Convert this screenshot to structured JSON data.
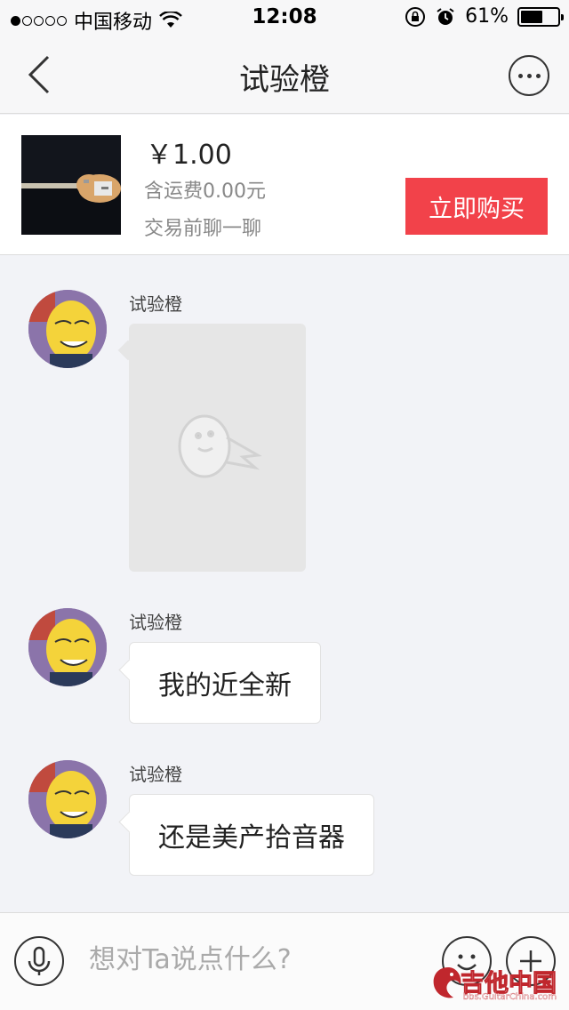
{
  "status_bar": {
    "carrier": "中国移动",
    "time": "12:08",
    "battery_percent": "61%",
    "battery_level": 0.61,
    "signal_bars_filled": 1,
    "signal_bars_total": 5
  },
  "nav": {
    "title": "试验橙"
  },
  "product": {
    "price": "￥1.00",
    "shipping": "含运费0.00元",
    "chat_hint": "交易前聊一聊",
    "buy_label": "立即购买"
  },
  "messages": [
    {
      "sender": "试验橙",
      "type": "image"
    },
    {
      "sender": "试验橙",
      "type": "text",
      "text": "我的近全新"
    },
    {
      "sender": "试验橙",
      "type": "text",
      "text": "还是美产拾音器"
    }
  ],
  "input": {
    "placeholder": "想对Ta说点什么?"
  },
  "watermark": {
    "title": "吉他中国",
    "url": "bbs.GuitarChina.com"
  },
  "colors": {
    "accent": "#f2424a",
    "background": "#f2f3f7"
  }
}
